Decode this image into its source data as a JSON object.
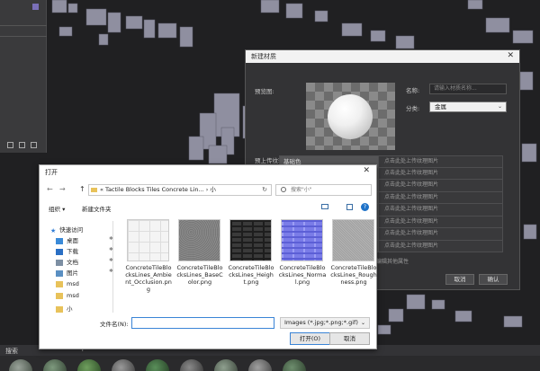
{
  "viewport": {
    "search_label": "搜索",
    "add_glyph": "+"
  },
  "material_dialog": {
    "title": "新建材质",
    "close": "✕",
    "preview_label": "预览图:",
    "name_label": "名称:",
    "name_placeholder": "请输入材质名称...",
    "category_label": "分类:",
    "category_value": "金属",
    "upload_label": "预上传纹理:",
    "textures": [
      {
        "name": "基础色",
        "action": "点击此处上传纹理图片"
      },
      {
        "name": "",
        "action": "点击此处上传纹理图片"
      },
      {
        "name": "",
        "action": "点击此处上传纹理图片"
      },
      {
        "name": "",
        "action": "点击此处上传纹理图片"
      },
      {
        "name": "",
        "action": "点击此处上传纹理图片"
      },
      {
        "name": "",
        "action": "点击此处上传纹理图片"
      },
      {
        "name": "",
        "action": "点击此处上传纹理图片"
      },
      {
        "name": "",
        "action": "点击此处上传纹理图片"
      }
    ],
    "other_props": "在编辑其他属性",
    "cancel_label": "取消",
    "confirm_label": "确认"
  },
  "file_dialog": {
    "title": "打开",
    "close": "✕",
    "back": "←",
    "forward": "→",
    "up": "↑",
    "address": "« Tactile Blocks Tiles Concrete Lin... › 小",
    "address_chevron": "⌄",
    "refresh": "↻",
    "search_placeholder": "搜索\"小\"",
    "organize": "组织 ▾",
    "new_folder": "新建文件夹",
    "help": "?",
    "sidebar": [
      {
        "label": "快速访问",
        "icon": "star-icon",
        "color": "#2f7cd6",
        "pinned": false
      },
      {
        "label": "桌面",
        "icon": "desktop-icon",
        "color": "#3a8ad8",
        "pinned": true
      },
      {
        "label": "下载",
        "icon": "download-icon",
        "color": "#2a6fc4",
        "pinned": true
      },
      {
        "label": "文档",
        "icon": "document-icon",
        "color": "#7d8fa3",
        "pinned": true
      },
      {
        "label": "图片",
        "icon": "pictures-icon",
        "color": "#5a8fc2",
        "pinned": true
      },
      {
        "label": "msd",
        "icon": "folder-icon",
        "color": "#e8c25a",
        "pinned": false
      },
      {
        "label": "msd",
        "icon": "folder-icon",
        "color": "#e8c25a",
        "pinned": false
      },
      {
        "label": "小",
        "icon": "folder-icon",
        "color": "#e8c25a",
        "pinned": false
      }
    ],
    "pin_glyph": "✱",
    "files": [
      {
        "name": "ConcreteTileBlocksLines_Ambient_Occlusion.png",
        "thumb": "ao"
      },
      {
        "name": "ConcreteTileBlocksLines_BaseColor.png",
        "thumb": "base"
      },
      {
        "name": "ConcreteTileBlocksLines_Height.png",
        "thumb": "height"
      },
      {
        "name": "ConcreteTileBlocksLines_Normal.png",
        "thumb": "normal"
      },
      {
        "name": "ConcreteTileBlocksLines_Roughness.png",
        "thumb": "rough"
      }
    ],
    "filename_label": "文件名(N):",
    "filename_value": "",
    "filter_value": "Images (*.jpg;*.png;*.gif)",
    "filter_chevron": "⌄",
    "open_label": "打开(O)",
    "cancel_label": "取消"
  }
}
